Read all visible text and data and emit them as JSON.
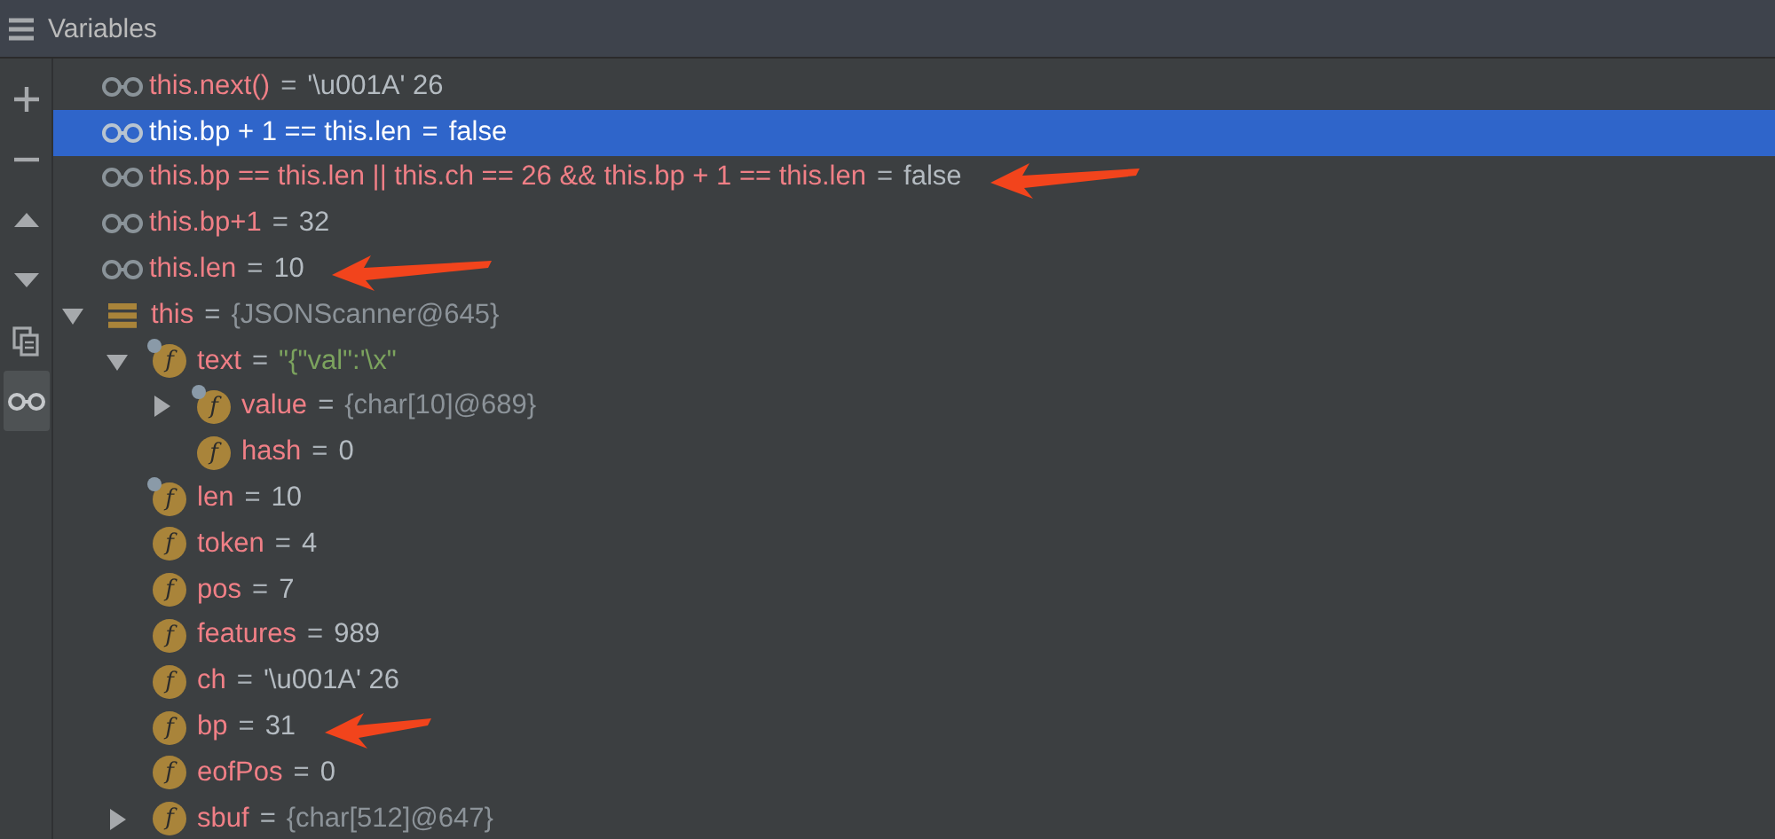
{
  "panel": {
    "title": "Variables"
  },
  "toolbar": [
    {
      "kind": "add",
      "selected": false
    },
    {
      "kind": "remove",
      "selected": false
    },
    {
      "kind": "up",
      "selected": false
    },
    {
      "kind": "down",
      "selected": false
    },
    {
      "kind": "copy",
      "selected": false
    },
    {
      "kind": "watches",
      "selected": true
    }
  ],
  "watches": [
    {
      "expression": "this.next()",
      "sep": "=",
      "value": "'\\u001A' 26",
      "selected": false,
      "annotated": false
    },
    {
      "expression": "this.bp + 1 == this.len",
      "sep": "=",
      "value": "false",
      "selected": true,
      "annotated": false
    },
    {
      "expression": "this.bp == this.len || this.ch == 26 && this.bp + 1 == this.len",
      "sep": "=",
      "value": "false",
      "selected": false,
      "annotated": true
    },
    {
      "expression": "this.bp+1",
      "sep": "=",
      "value": "32",
      "selected": false,
      "annotated": false
    },
    {
      "expression": "this.len",
      "sep": "=",
      "value": "10",
      "selected": false,
      "annotated": true
    }
  ],
  "variables": [
    {
      "kind": "object",
      "name": "this",
      "sep": "=",
      "value": {
        "kind": "object",
        "text": "{JSONScanner@645}"
      },
      "expanded": true,
      "annotated": false,
      "children": [
        {
          "kind": "field",
          "icon": "f",
          "badge": true,
          "name": "text",
          "sep": "=",
          "value": {
            "kind": "string",
            "text": "\"{\"val\":'\\x\""
          },
          "expanded": true,
          "annotated": false,
          "children": [
            {
              "kind": "field",
              "icon": "f",
              "badge": true,
              "name": "value",
              "sep": "=",
              "value": {
                "kind": "object",
                "text": "{char[10]@689}"
              },
              "expanded": false,
              "annotated": false
            },
            {
              "kind": "field",
              "icon": "f",
              "badge": false,
              "name": "hash",
              "sep": "=",
              "value": {
                "kind": "primitive",
                "text": "0"
              },
              "annotated": false
            }
          ]
        },
        {
          "kind": "field",
          "icon": "f",
          "badge": true,
          "name": "len",
          "sep": "=",
          "value": {
            "kind": "primitive",
            "text": "10"
          },
          "annotated": false
        },
        {
          "kind": "field",
          "icon": "f",
          "badge": false,
          "name": "token",
          "sep": "=",
          "value": {
            "kind": "primitive",
            "text": "4"
          },
          "annotated": false
        },
        {
          "kind": "field",
          "icon": "f",
          "badge": false,
          "name": "pos",
          "sep": "=",
          "value": {
            "kind": "primitive",
            "text": "7"
          },
          "annotated": false
        },
        {
          "kind": "field",
          "icon": "f",
          "badge": false,
          "name": "features",
          "sep": "=",
          "value": {
            "kind": "primitive",
            "text": "989"
          },
          "annotated": false
        },
        {
          "kind": "field",
          "icon": "f",
          "badge": false,
          "name": "ch",
          "sep": "=",
          "value": {
            "kind": "primitive",
            "text": "'\\u001A' 26"
          },
          "annotated": false
        },
        {
          "kind": "field",
          "icon": "f",
          "badge": false,
          "name": "bp",
          "sep": "=",
          "value": {
            "kind": "primitive",
            "text": "31"
          },
          "annotated": true
        },
        {
          "kind": "field",
          "icon": "f",
          "badge": false,
          "name": "eofPos",
          "sep": "=",
          "value": {
            "kind": "primitive",
            "text": "0"
          },
          "annotated": false
        },
        {
          "kind": "field",
          "icon": "f",
          "badge": false,
          "name": "sbuf",
          "sep": "=",
          "value": {
            "kind": "object",
            "text": "{char[512]@647}"
          },
          "expanded": false,
          "annotated": false
        }
      ]
    }
  ]
}
